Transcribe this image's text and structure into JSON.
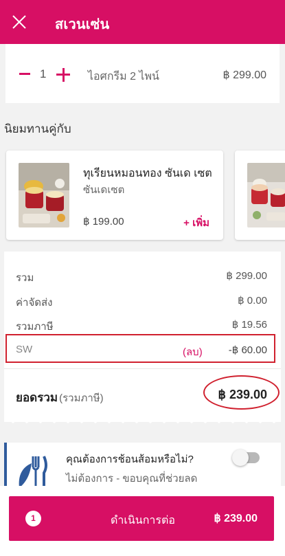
{
  "header": {
    "title": "สเวนเซ่น"
  },
  "cart_item": {
    "quantity": "1",
    "name": "ไอศกรีม 2 ไพน์",
    "price": "฿ 299.00"
  },
  "recommendations": {
    "title": "นิยมทานคู่กับ",
    "items": [
      {
        "name": "ทุเรียนหมอนทอง ซันเด เซต",
        "subtitle": "ซันเดเซต",
        "price": "฿ 199.00",
        "add_label": "+ เพิ่ม"
      }
    ]
  },
  "summary": {
    "rows": [
      {
        "label": "รวม",
        "value": "฿ 299.00"
      },
      {
        "label": "ค่าจัดส่ง",
        "value": "฿ 0.00"
      },
      {
        "label": "รวมภาษี",
        "value": "฿ 19.56"
      }
    ],
    "discount": {
      "code": "SW",
      "note": "(ลบ)",
      "value": "-฿ 60.00"
    },
    "total": {
      "label": "ยอดรวม",
      "sub": "(รวมภาษี)",
      "value": "฿ 239.00"
    }
  },
  "cutlery": {
    "question": "คุณต้องการช้อนส้อมหรือไม่?",
    "answer": "ไม่ต้องการ - ขอบคุณที่ช่วยลด",
    "toggle_on": false
  },
  "checkout": {
    "count": "1",
    "label": "ดำเนินการต่อ",
    "amount": "฿ 239.00"
  },
  "colors": {
    "brand": "#d70f64",
    "highlight": "#d0202e",
    "accent": "#2f5b9c"
  }
}
